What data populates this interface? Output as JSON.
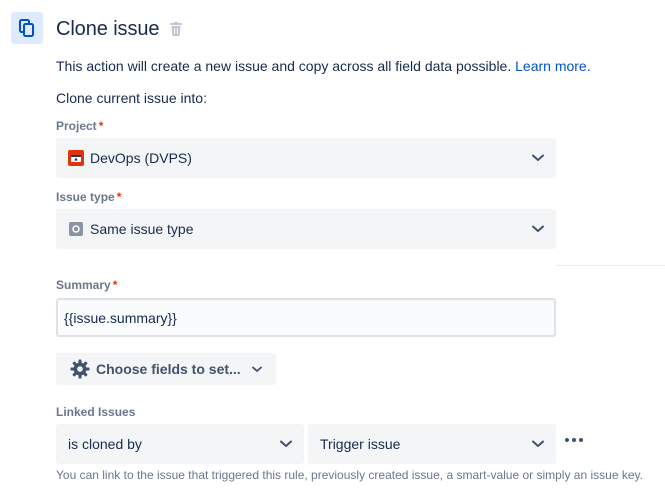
{
  "header": {
    "title": "Clone issue",
    "icon": "copy-icon",
    "delete_icon": "trash-icon"
  },
  "description": {
    "text": "This action will create a new issue and copy across all field data possible.",
    "link_text": "Learn more."
  },
  "subheading": "Clone current issue into:",
  "project": {
    "label": "Project",
    "required_mark": "*",
    "value": "DevOps (DVPS)",
    "icon": "devops-project-icon"
  },
  "issue_type": {
    "label": "Issue type",
    "required_mark": "*",
    "value": "Same issue type",
    "icon": "issue-type-icon"
  },
  "summary": {
    "label": "Summary",
    "required_mark": "*",
    "value": "{{issue.summary}}"
  },
  "fields_button": {
    "label": "Choose fields to set...",
    "icon": "gear-icon"
  },
  "linked_issues": {
    "label": "Linked Issues",
    "relation": "is cloned by",
    "target": "Trigger issue",
    "more_icon": "more-icon",
    "help": "You can link to the issue that triggered this rule, previously created issue, a smart-value or simply an issue key."
  },
  "colors": {
    "accent": "#0052cc",
    "required": "#de350b",
    "label": "#6b778c",
    "text": "#172b4d",
    "field_bg": "#f4f5f7",
    "project_icon": "#de350b"
  }
}
